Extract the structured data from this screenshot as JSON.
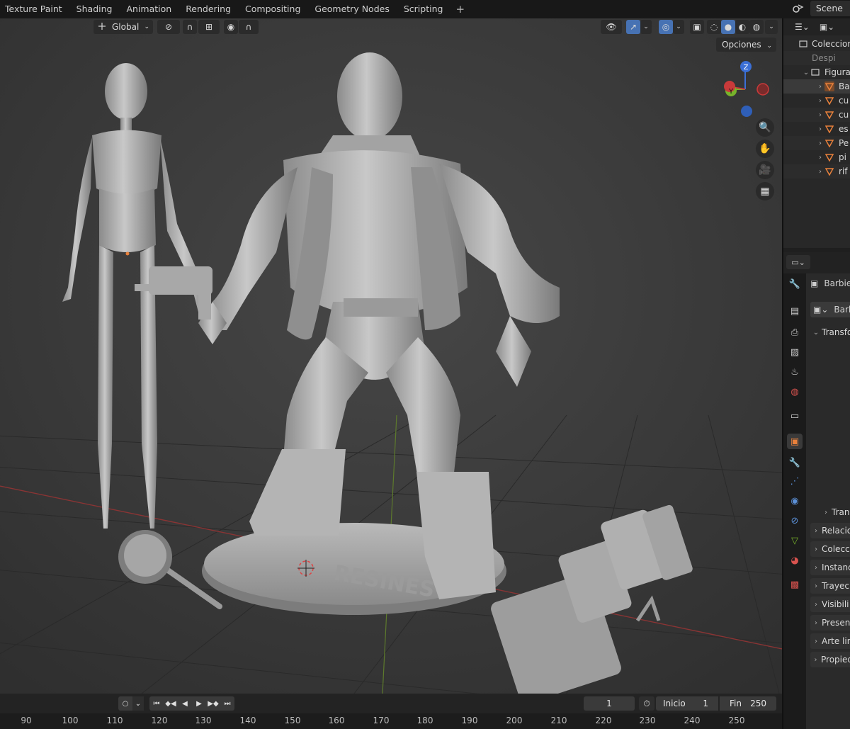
{
  "workspace_tabs": [
    "Texture Paint",
    "Shading",
    "Animation",
    "Rendering",
    "Compositing",
    "Geometry Nodes",
    "Scripting"
  ],
  "add_tab": "+",
  "scene": {
    "label": "Scene"
  },
  "viewport": {
    "orientation": "Global",
    "options_label": "Opciones",
    "gizmo": {
      "z": "Z",
      "y": "Y"
    },
    "base_text": "RESINES"
  },
  "timeline": {
    "current_frame": "1",
    "start_label": "Inicio",
    "start_value": "1",
    "end_label": "Fin",
    "end_value": "250",
    "ruler": [
      "90",
      "100",
      "110",
      "120",
      "130",
      "140",
      "150",
      "160",
      "170",
      "180",
      "190",
      "200",
      "210",
      "220",
      "230",
      "240",
      "250"
    ]
  },
  "outliner": {
    "collection": "Coleccion",
    "hidden_row": "Despi",
    "group": "Figura",
    "objects": [
      "Ba",
      "cu",
      "cu",
      "es",
      "Pe",
      "pi",
      "rif"
    ]
  },
  "properties": {
    "object_name": "Barbie",
    "data_name": "Barl",
    "sections": {
      "transform": "Transfo",
      "delta": "Tran",
      "relations": "Relacio",
      "collections": "Colecc",
      "instancing": "Instanc",
      "motion_paths": "Trayec",
      "visibility": "Visibili",
      "viewport_display": "Presen",
      "line_art": "Arte lin",
      "custom_props": "Propied"
    }
  },
  "colors": {
    "accent_blue": "#4772b3",
    "object_orange": "#e8803b",
    "axis_red": "#c93a3a",
    "axis_green": "#78b32b",
    "axis_blue": "#3b6fd6"
  }
}
